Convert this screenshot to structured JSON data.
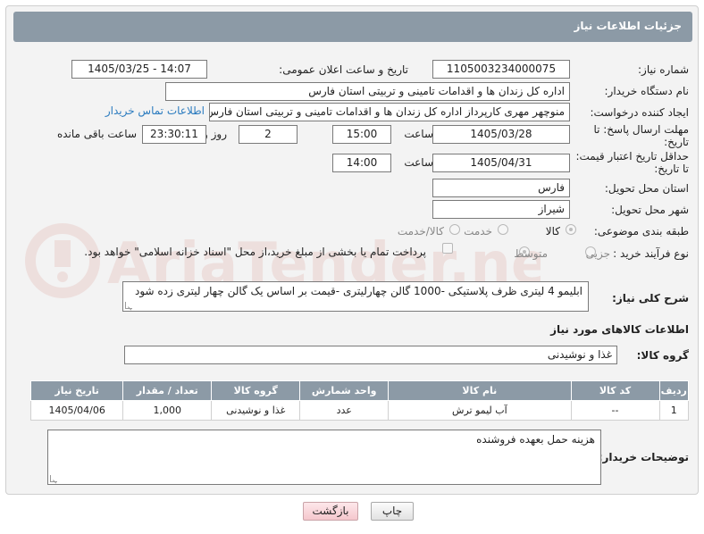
{
  "header": {
    "title": "جزئیات اطلاعات نیاز"
  },
  "watermark": {
    "text": "AriaTender.net"
  },
  "labels": {
    "need_number": "شماره نیاز:",
    "announce_datetime": "تاریخ و ساعت اعلان عمومی:",
    "buyer_org": "نام دستگاه خریدار:",
    "requester": "ایجاد کننده درخواست:",
    "deadline": "مهلت ارسال پاسخ: تا تاریخ:",
    "hour": "ساعت",
    "day_and": "روز و",
    "remaining": "ساعت باقی مانده",
    "min_price_validity": "حداقل تاریخ اعتبار قیمت: تا تاریخ:",
    "delivery_province": "استان محل تحویل:",
    "delivery_city": "شهر محل تحویل:",
    "category": "طبقه بندی موضوعی:",
    "process_type": "نوع فرآیند خرید :",
    "general_desc": "شرح کلی نیاز:",
    "goods_info": "اطلاعات کالاهای مورد نیاز",
    "goods_group": "گروه کالا:",
    "buyer_notes": "توضیحات خریدار:"
  },
  "values": {
    "need_number": "1105003234000075",
    "announce_datetime": "1405/03/25 - 14:07",
    "buyer_org": "اداره کل زندان ها و اقدامات تامینی و تربیتی استان فارس",
    "requester": "منوچهر  مهری  کارپرداز اداره کل زندان ها و اقدامات تامینی و تربیتی استان فارس",
    "contact_link": "اطلاعات تماس خریدار",
    "deadline_date": "1405/03/28",
    "deadline_time": "15:00",
    "days": "2",
    "remaining_time": "23:30:11",
    "price_validity_date": "1405/04/31",
    "price_validity_time": "14:00",
    "province": "فارس",
    "city": "شیراز",
    "general_desc": "ابلیمو 4 لیتری ظرف پلاستیکی -1000 گالن چهارلیتری -قیمت بر اساس یک گالن چهار لیتری زده شود",
    "goods_group": "غذا و نوشیدنی",
    "buyer_notes": "هزینه حمل بعهده فروشنده"
  },
  "category_options": [
    "کالا",
    "خدمت",
    "کالا/خدمت"
  ],
  "category_selected": "کالا",
  "process_options": [
    "جزیی",
    "متوسط"
  ],
  "process_selected": "متوسط",
  "payment_note": "پرداخت تمام یا بخشی از مبلغ خرید،از محل \"اسناد خزانه اسلامی\" خواهد بود.",
  "table": {
    "headers": [
      "ردیف",
      "کد کالا",
      "نام کالا",
      "واحد شمارش",
      "گروه کالا",
      "تعداد / مقدار",
      "تاریخ نیاز"
    ],
    "rows": [
      [
        "1",
        "--",
        "آب لیمو ترش",
        "عدد",
        "غذا و نوشیدنی",
        "1,000",
        "1405/04/06"
      ]
    ]
  },
  "buttons": {
    "print": "چاپ",
    "back": "بازگشت"
  }
}
